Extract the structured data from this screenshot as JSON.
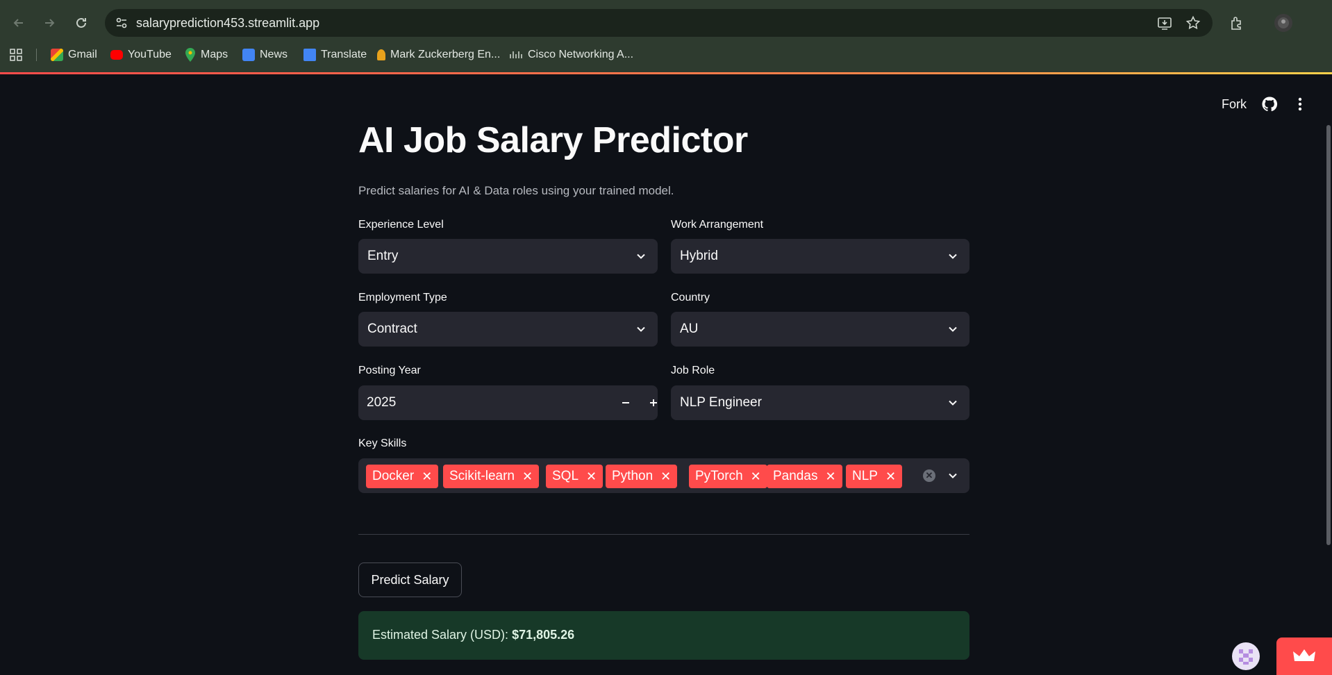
{
  "browser": {
    "url": "salaryprediction453.streamlit.app",
    "bookmarks": [
      "Gmail",
      "YouTube",
      "Maps",
      "News",
      "Translate",
      "Mark Zuckerberg En...",
      "Cisco Networking A..."
    ]
  },
  "header": {
    "fork_label": "Fork"
  },
  "main": {
    "title": "AI Job Salary Predictor",
    "subtitle": "Predict salaries for AI & Data roles using your trained model.",
    "fields": {
      "experience_level": {
        "label": "Experience Level",
        "value": "Entry"
      },
      "work_arrangement": {
        "label": "Work Arrangement",
        "value": "Hybrid"
      },
      "employment_type": {
        "label": "Employment Type",
        "value": "Contract"
      },
      "country": {
        "label": "Country",
        "value": "AU"
      },
      "posting_year": {
        "label": "Posting Year",
        "value": "2025"
      },
      "job_role": {
        "label": "Job Role",
        "value": "NLP Engineer"
      },
      "key_skills": {
        "label": "Key Skills",
        "values": [
          "Docker",
          "Scikit-learn",
          "SQL",
          "Python",
          "PyTorch",
          "Pandas",
          "NLP"
        ]
      }
    },
    "predict_button": "Predict Salary",
    "result": {
      "prefix": "Estimated Salary (USD):",
      "amount": "$71,805.26"
    }
  },
  "colors": {
    "background": "#0e1117",
    "input_bg": "#262730",
    "accent": "#ff4b4b",
    "success_bg": "#173928",
    "chrome_bg": "#2e3b2f"
  }
}
